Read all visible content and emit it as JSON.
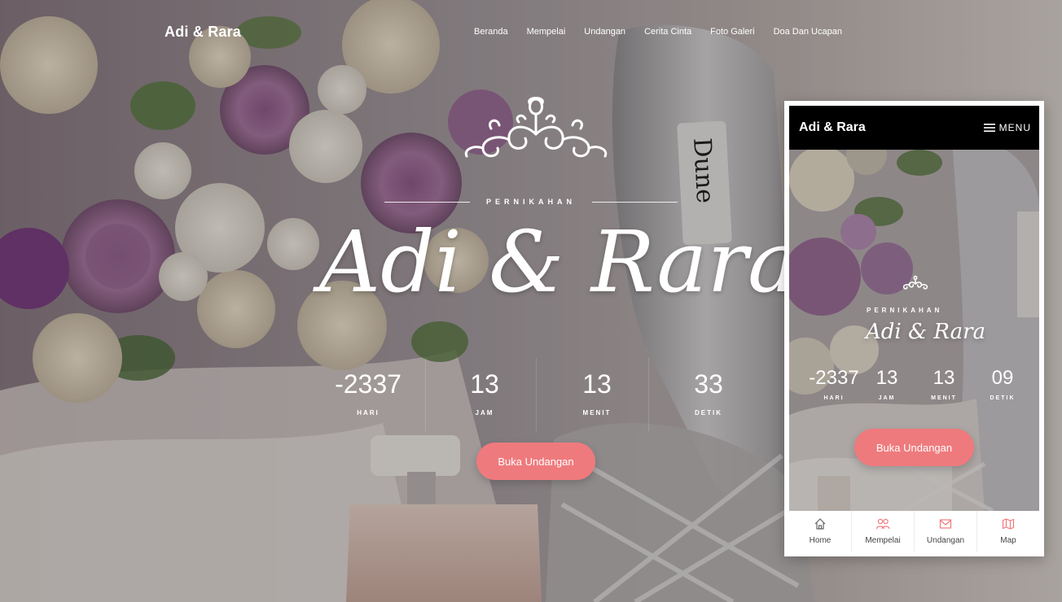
{
  "nav": {
    "brand": "Adi & Rara",
    "menu": [
      "Beranda",
      "Mempelai",
      "Undangan",
      "Cerita Cinta",
      "Foto Galeri",
      "Doa Dan Ucapan"
    ]
  },
  "hero": {
    "eyebrow": "PERNIKAHAN",
    "couple": "Adi & Rara",
    "countdown": [
      {
        "value": "-2337",
        "label": "HARI"
      },
      {
        "value": "13",
        "label": "JAM"
      },
      {
        "value": "13",
        "label": "MENIT"
      },
      {
        "value": "33",
        "label": "DETIK"
      }
    ],
    "button": "Buka Undangan"
  },
  "phone": {
    "brand": "Adi & Rara",
    "menu_label": "MENU",
    "eyebrow": "PERNIKAHAN",
    "couple": "Adi & Rara",
    "countdown": [
      {
        "value": "-2337",
        "label": "HARI"
      },
      {
        "value": "13",
        "label": "JAM"
      },
      {
        "value": "13",
        "label": "MENIT"
      },
      {
        "value": "09",
        "label": "DETIK"
      }
    ],
    "button": "Buka Undangan",
    "tabs": [
      {
        "label": "Home",
        "icon": "home-icon"
      },
      {
        "label": "Mempelai",
        "icon": "couple-icon"
      },
      {
        "label": "Undangan",
        "icon": "envelope-icon"
      },
      {
        "label": "Map",
        "icon": "map-icon"
      }
    ]
  },
  "colors": {
    "accent": "#ef7a7d",
    "phone_bar": "#000000"
  }
}
